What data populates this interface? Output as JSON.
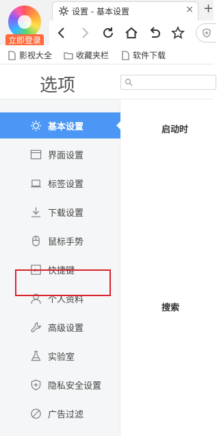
{
  "browser": {
    "login_badge": "立即登录",
    "tab_title": "设置 - 基本设置",
    "tab_close": "×",
    "new_tab": "+"
  },
  "bookmarks": [
    {
      "label": "影视大全"
    },
    {
      "label": "收藏夹栏"
    },
    {
      "label": "软件下载"
    }
  ],
  "settings": {
    "title": "选项",
    "search_placeholder": ""
  },
  "sidebar": {
    "items": [
      {
        "label": "基本设置",
        "icon": "gear-icon",
        "active": true
      },
      {
        "label": "界面设置",
        "icon": "window-icon"
      },
      {
        "label": "标签设置",
        "icon": "laptop-icon"
      },
      {
        "label": "下载设置",
        "icon": "download-icon"
      },
      {
        "label": "鼠标手势",
        "icon": "mouse-icon"
      },
      {
        "label": "快捷键",
        "icon": "keyboard-shortcut-icon"
      },
      {
        "label": "个人资料",
        "icon": "person-icon"
      },
      {
        "label": "高级设置",
        "icon": "wrench-icon"
      },
      {
        "label": "实验室",
        "icon": "flask-icon"
      },
      {
        "label": "隐私安全设置",
        "icon": "shield-icon",
        "highlighted": true
      },
      {
        "label": "广告过滤",
        "icon": "block-icon"
      }
    ]
  },
  "content": {
    "sections": [
      {
        "title": "启动时"
      },
      {
        "title": "搜索"
      }
    ]
  },
  "colors": {
    "accent": "#4c97f5",
    "highlight_border": "#d9232d",
    "login_badge": "#ff6a3d",
    "sidebar_bg": "#f5f6f7"
  }
}
